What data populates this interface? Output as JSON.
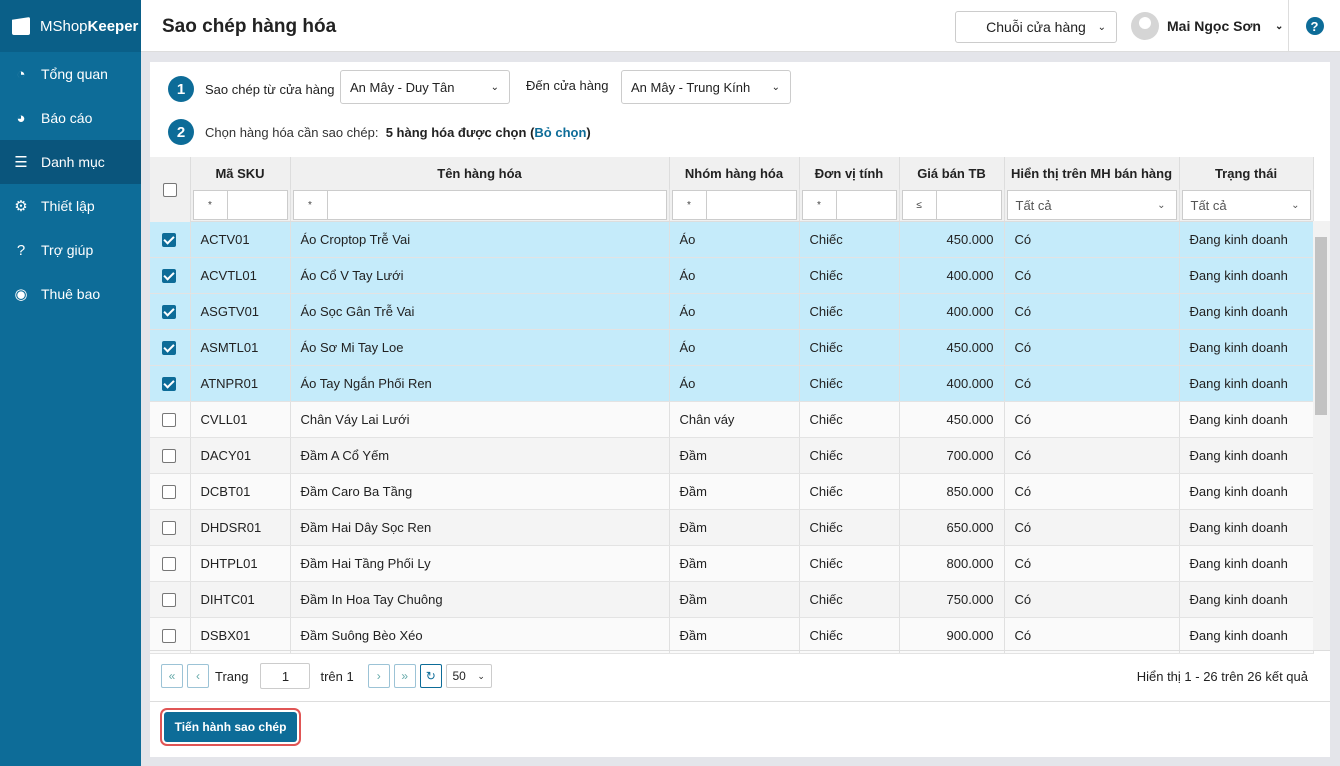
{
  "sidebar": {
    "brand_prefix": "MShop",
    "brand_suffix": "Keeper",
    "items": [
      {
        "label": "Tổng quan",
        "icon": "dashboard-icon"
      },
      {
        "label": "Báo cáo",
        "icon": "pie-chart-icon"
      },
      {
        "label": "Danh mục",
        "icon": "list-icon",
        "active": true
      },
      {
        "label": "Thiết lập",
        "icon": "gear-icon"
      },
      {
        "label": "Trợ giúp",
        "icon": "help-icon"
      },
      {
        "label": "Thuê bao",
        "icon": "user-icon"
      }
    ]
  },
  "header": {
    "title": "Sao chép hàng hóa",
    "chain_select": "Chuỗi cửa hàng",
    "user_name": "Mai Ngọc Sơn",
    "help": "?"
  },
  "step1": {
    "num": "1",
    "from_label": "Sao chép từ cửa hàng",
    "from_value": "An Mây - Duy Tân",
    "to_label": "Đến cửa hàng",
    "to_value": "An Mây - Trung Kính"
  },
  "step2": {
    "num": "2",
    "label": "Chọn hàng hóa cần sao chép:",
    "selected": "5 hàng hóa được chọn",
    "open": "(",
    "deselect": "Bỏ chọn",
    "close": ")"
  },
  "table": {
    "columns": [
      "Mã SKU",
      "Tên hàng hóa",
      "Nhóm hàng hóa",
      "Đơn vị tính",
      "Giá bán TB",
      "Hiển thị trên MH bán hàng",
      "Trạng thái"
    ],
    "filters": {
      "sku_op": "*",
      "name_op": "*",
      "group_op": "*",
      "unit_op": "*",
      "price_op": "≤",
      "display": "Tất cả",
      "status": "Tất cả"
    },
    "rows": [
      {
        "checked": true,
        "sku": "ACTV01",
        "name": "Áo Croptop Trễ Vai",
        "group": "Áo",
        "unit": "Chiếc",
        "price": "450.000",
        "display": "Có",
        "status": "Đang kinh doanh"
      },
      {
        "checked": true,
        "sku": "ACVTL01",
        "name": "Áo Cổ V Tay Lưới",
        "group": "Áo",
        "unit": "Chiếc",
        "price": "400.000",
        "display": "Có",
        "status": "Đang kinh doanh"
      },
      {
        "checked": true,
        "sku": "ASGTV01",
        "name": "Áo Sọc Gân Trễ Vai",
        "group": "Áo",
        "unit": "Chiếc",
        "price": "400.000",
        "display": "Có",
        "status": "Đang kinh doanh"
      },
      {
        "checked": true,
        "sku": "ASMTL01",
        "name": "Áo Sơ Mi Tay Loe",
        "group": "Áo",
        "unit": "Chiếc",
        "price": "450.000",
        "display": "Có",
        "status": "Đang kinh doanh"
      },
      {
        "checked": true,
        "sku": "ATNPR01",
        "name": "Áo Tay Ngắn Phối Ren",
        "group": "Áo",
        "unit": "Chiếc",
        "price": "400.000",
        "display": "Có",
        "status": "Đang kinh doanh"
      },
      {
        "checked": false,
        "sku": "CVLL01",
        "name": "Chân Váy Lai Lưới",
        "group": "Chân váy",
        "unit": "Chiếc",
        "price": "450.000",
        "display": "Có",
        "status": "Đang kinh doanh"
      },
      {
        "checked": false,
        "sku": "DACY01",
        "name": "Đầm A Cổ Yếm",
        "group": "Đầm",
        "unit": "Chiếc",
        "price": "700.000",
        "display": "Có",
        "status": "Đang kinh doanh"
      },
      {
        "checked": false,
        "sku": "DCBT01",
        "name": "Đầm Caro Ba Tầng",
        "group": "Đầm",
        "unit": "Chiếc",
        "price": "850.000",
        "display": "Có",
        "status": "Đang kinh doanh"
      },
      {
        "checked": false,
        "sku": "DHDSR01",
        "name": "Đầm Hai Dây Sọc Ren",
        "group": "Đầm",
        "unit": "Chiếc",
        "price": "650.000",
        "display": "Có",
        "status": "Đang kinh doanh"
      },
      {
        "checked": false,
        "sku": "DHTPL01",
        "name": "Đầm Hai Tầng Phối Ly",
        "group": "Đầm",
        "unit": "Chiếc",
        "price": "800.000",
        "display": "Có",
        "status": "Đang kinh doanh"
      },
      {
        "checked": false,
        "sku": "DIHTC01",
        "name": "Đầm In Hoa Tay Chuông",
        "group": "Đầm",
        "unit": "Chiếc",
        "price": "750.000",
        "display": "Có",
        "status": "Đang kinh doanh"
      },
      {
        "checked": false,
        "sku": "DSBX01",
        "name": "Đầm Suông Bèo Xéo",
        "group": "Đầm",
        "unit": "Chiếc",
        "price": "900.000",
        "display": "Có",
        "status": "Đang kinh doanh"
      }
    ]
  },
  "pager": {
    "page_label": "Trang",
    "page": "1",
    "of_label": "trên 1",
    "page_size": "50",
    "result": "Hiển thị 1 - 26 trên 26 kết quả"
  },
  "action": {
    "copy_button": "Tiến hành sao chép"
  }
}
